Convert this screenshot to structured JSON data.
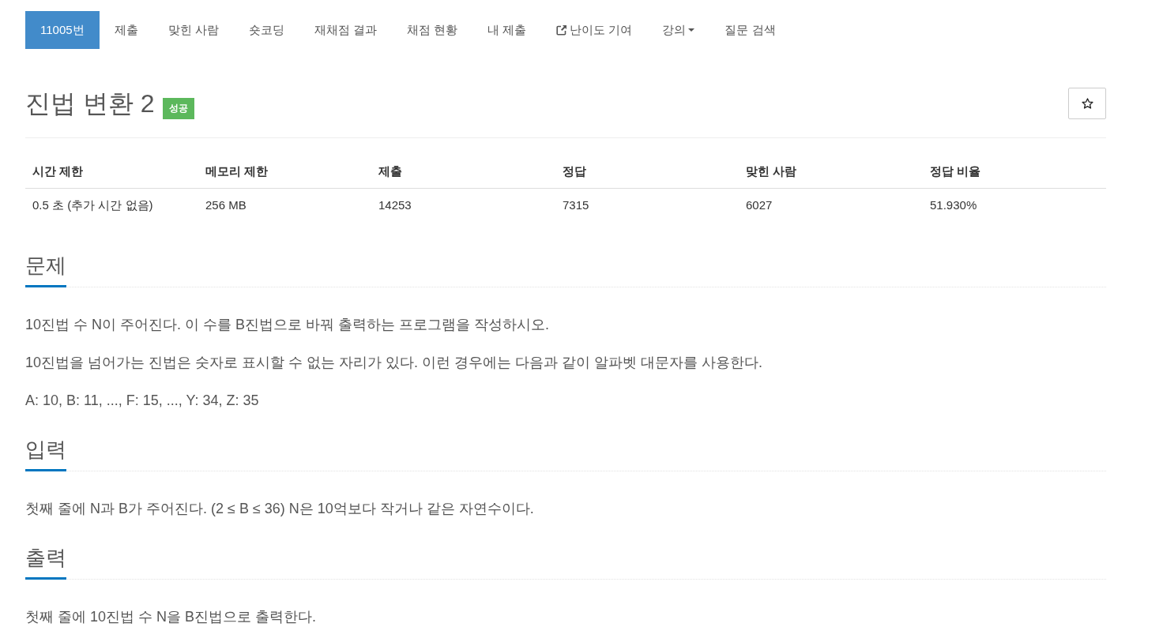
{
  "tabs": [
    {
      "label": "11005번",
      "kind": "plain",
      "selected": true
    },
    {
      "label": "제출",
      "kind": "plain",
      "selected": false
    },
    {
      "label": "맞힌 사람",
      "kind": "plain",
      "selected": false
    },
    {
      "label": "숏코딩",
      "kind": "plain",
      "selected": false
    },
    {
      "label": "재채점 결과",
      "kind": "plain",
      "selected": false
    },
    {
      "label": "채점 현황",
      "kind": "plain",
      "selected": false
    },
    {
      "label": "내 제출",
      "kind": "plain",
      "selected": false
    },
    {
      "label": "난이도 기여",
      "kind": "external",
      "selected": false
    },
    {
      "label": "강의",
      "kind": "dropdown",
      "selected": false
    },
    {
      "label": "질문 검색",
      "kind": "plain",
      "selected": false
    }
  ],
  "problem": {
    "title": "진법 변환 2",
    "badge": "성공"
  },
  "stats_table": {
    "columns": [
      "시간 제한",
      "메모리 제한",
      "제출",
      "정답",
      "맞힌 사람",
      "정답 비율"
    ],
    "rows": [
      [
        "0.5 초 (추가 시간 없음)",
        "256 MB",
        "14253",
        "7315",
        "6027",
        "51.930%"
      ]
    ]
  },
  "sections": [
    {
      "heading": "문제",
      "paragraphs": [
        "10진법 수 N이 주어진다. 이 수를 B진법으로 바꿔 출력하는 프로그램을 작성하시오.",
        "10진법을 넘어가는 진법은 숫자로 표시할 수 없는 자리가 있다. 이런 경우에는 다음과 같이 알파벳 대문자를 사용한다.",
        "A: 10, B: 11, ..., F: 15, ..., Y: 34, Z: 35"
      ]
    },
    {
      "heading": "입력",
      "paragraphs": [
        "첫째 줄에 N과 B가 주어진다. (2 ≤ B ≤ 36) N은 10억보다 작거나 같은 자연수이다."
      ]
    },
    {
      "heading": "출력",
      "paragraphs": [
        "첫째 줄에 10진법 수 N을 B진법으로 출력한다."
      ]
    }
  ]
}
